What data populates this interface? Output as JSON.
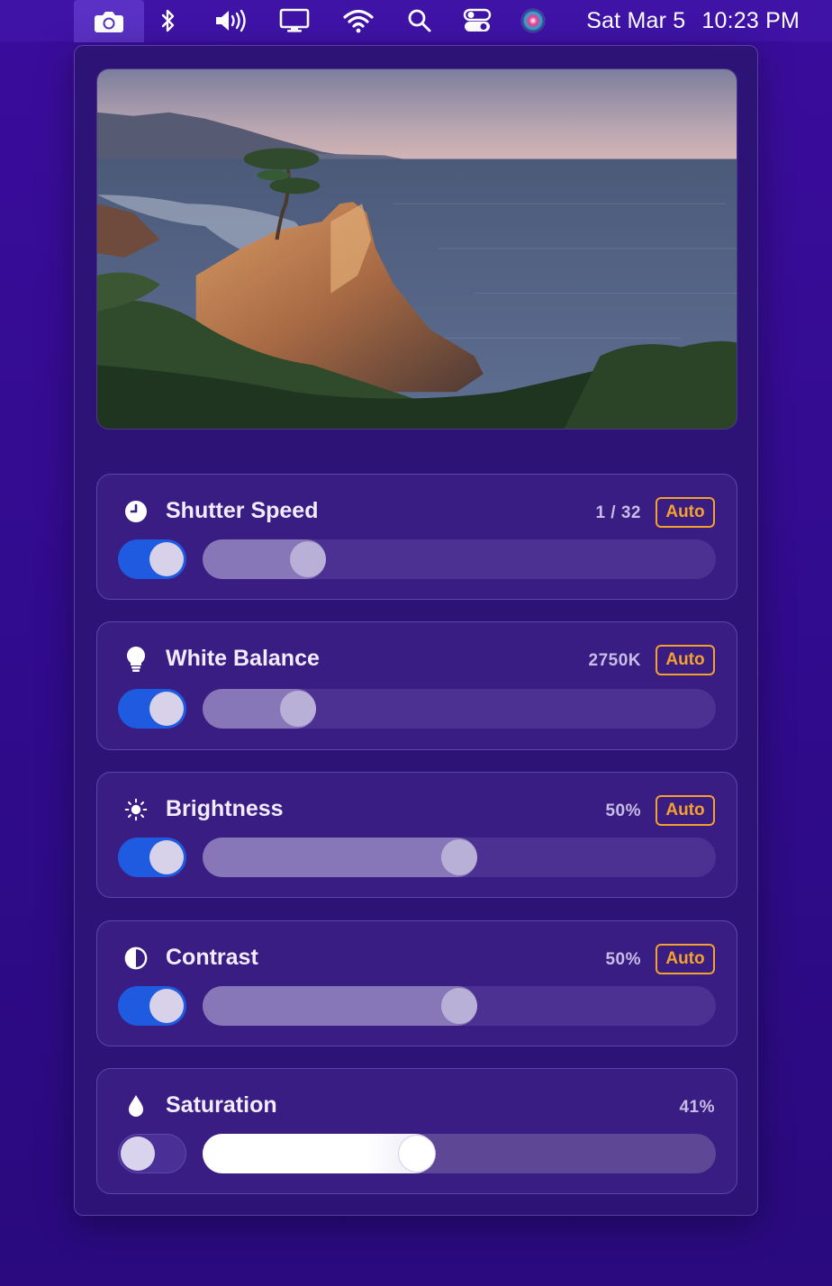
{
  "menubar": {
    "icons": [
      "camera-icon",
      "bluetooth-icon",
      "volume-icon",
      "display-icon",
      "wifi-icon",
      "search-icon",
      "control-center-icon",
      "siri-icon"
    ],
    "date": "Sat Mar 5",
    "time": "10:23 PM"
  },
  "photo": {
    "description_icon": "landscape-photo"
  },
  "controls": [
    {
      "title": "Shutter Speed",
      "value": "1 / 32",
      "auto_label": "Auto",
      "icon": "clock-icon",
      "enabled": true,
      "level": 0.18
    },
    {
      "title": "White Balance",
      "value": "2750K",
      "auto_label": "Auto",
      "icon": "lightbulb-icon",
      "enabled": true,
      "level": 0.16
    },
    {
      "title": "Brightness",
      "value": "50%",
      "auto_label": "Auto",
      "icon": "sun-icon",
      "enabled": true,
      "level": 0.5
    },
    {
      "title": "Contrast",
      "value": "50%",
      "auto_label": "Auto",
      "icon": "contrast-icon",
      "enabled": true,
      "level": 0.5
    },
    {
      "title": "Saturation",
      "value": "41%",
      "icon": "droplet-icon",
      "enabled": false,
      "level": 0.41
    }
  ],
  "colors": {
    "accent": "#f4a12e",
    "toggle_on": "#1e5be0",
    "background": "#3a0d9c"
  }
}
